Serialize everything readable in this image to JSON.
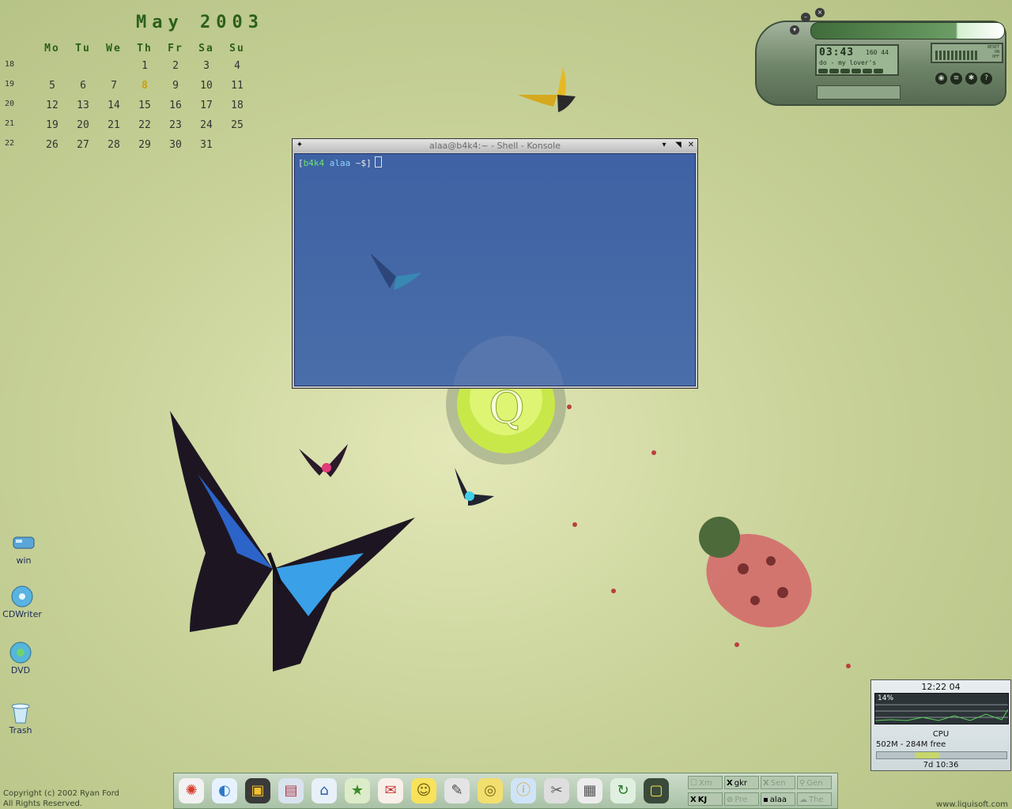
{
  "calendar": {
    "title": "May 2003",
    "day_headers": [
      "Mo",
      "Tu",
      "We",
      "Th",
      "Fr",
      "Sa",
      "Su"
    ],
    "today": "8",
    "weeks": [
      {
        "week": "18",
        "days": [
          "",
          "",
          "",
          "1",
          "2",
          "3",
          "4"
        ]
      },
      {
        "week": "19",
        "days": [
          "5",
          "6",
          "7",
          "8",
          "9",
          "10",
          "11"
        ]
      },
      {
        "week": "20",
        "days": [
          "12",
          "13",
          "14",
          "15",
          "16",
          "17",
          "18"
        ]
      },
      {
        "week": "21",
        "days": [
          "19",
          "20",
          "21",
          "22",
          "23",
          "24",
          "25"
        ]
      },
      {
        "week": "22",
        "days": [
          "26",
          "27",
          "28",
          "29",
          "30",
          "31",
          ""
        ]
      }
    ]
  },
  "player": {
    "time": "03:43",
    "rate": "160 44",
    "song": "do - my lover's",
    "status_text": [
      "RESET",
      "ON",
      "OFF"
    ],
    "progress": 0.76
  },
  "konsole": {
    "title": "alaa@b4k4:~ - Shell - Konsole",
    "prompt_open": "[",
    "prompt_host": "b4k4",
    "prompt_user": "alaa",
    "prompt_path": "~$]"
  },
  "desktop_icons": [
    {
      "label": "win",
      "icon": "drive-icon"
    },
    {
      "label": "CDWriter",
      "icon": "cdwriter-icon"
    },
    {
      "label": "DVD",
      "icon": "dvd-icon"
    },
    {
      "label": "Trash",
      "icon": "trash-icon"
    }
  ],
  "footer": {
    "copyright_line1": "Copyright (c) 2002 Ryan Ford",
    "copyright_line2": "All Rights Reserved.",
    "website": "www.liquisoft.com"
  },
  "taskbar": {
    "launchers": [
      "kmenu-icon",
      "konqueror-icon",
      "terminal-icon",
      "control-center-icon",
      "home-icon",
      "star-icon",
      "mail-icon",
      "smiley-icon",
      "tools-icon",
      "cd-icon",
      "info-icon",
      "gimp-icon",
      "calculator-icon",
      "update-icon",
      "monitor-icon"
    ],
    "tasks": [
      {
        "label": "Xm"
      },
      {
        "label": "gkr"
      },
      {
        "label": "Sen"
      },
      {
        "label": "Gen"
      },
      {
        "label": "KJ"
      },
      {
        "label": "Pre"
      },
      {
        "label": "alaa"
      },
      {
        "label": "The"
      }
    ]
  },
  "sysmon": {
    "time": "12:22 04",
    "cpu_percent": "14%",
    "cpu_label": "CPU",
    "memory": "502M - 284M free",
    "uptime": "7d 10:36"
  },
  "colors": {
    "desktop_bg": "#c9d39a",
    "konsole_bg": "#4a6ea9",
    "calendar_accent": "#2c5f1d",
    "today_highlight": "#c9a10a"
  }
}
